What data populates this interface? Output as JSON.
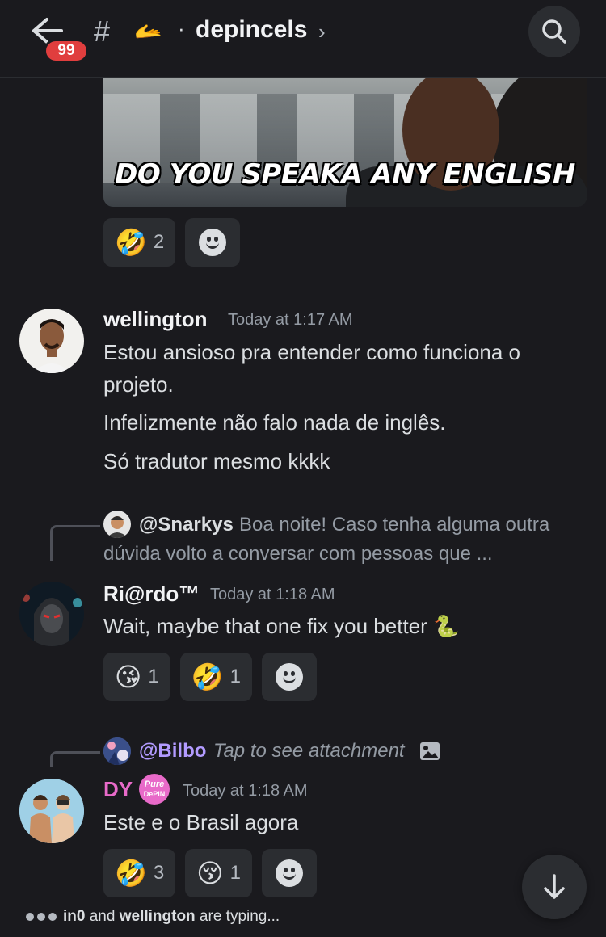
{
  "header": {
    "unread_badge": "99",
    "channel_hash": "#",
    "channel_emoji": "🫴",
    "channel_separator": "·",
    "channel_name": "depincels",
    "chevron": "›"
  },
  "embed": {
    "caption": "DO YOU SPEAKA ANY ENGLISH",
    "reactions": [
      {
        "emoji": "🤣",
        "count": "2"
      }
    ]
  },
  "messages": [
    {
      "username": "wellington",
      "timestamp": "Today at 1:17 AM",
      "lines": [
        "Estou ansioso pra entender como funciona o projeto.",
        "Infelizmente não falo nada de inglês.",
        "Só tradutor mesmo kkkk"
      ]
    },
    {
      "reply": {
        "name": "@Snarkys",
        "text": "Boa noite! Caso tenha alguma outra dúvida volto a conversar com pessoas que ..."
      },
      "username": "Ri@rdo™",
      "timestamp": "Today at 1:18 AM",
      "text": "Wait, maybe that one fix you better",
      "text_emoji": "🐍",
      "reactions": [
        {
          "emoji": "😘",
          "count": "1"
        },
        {
          "emoji": "🤣",
          "count": "1"
        }
      ]
    },
    {
      "reply": {
        "name": "@Bilbo",
        "text": "Tap to see attachment"
      },
      "username": "DY",
      "tag_line1": "Pure",
      "tag_line2": "DePIN",
      "timestamp": "Today at 1:18 AM",
      "text": "Este e o Brasil agora",
      "reactions": [
        {
          "emoji": "🤣",
          "count": "3"
        },
        {
          "emoji": "😚",
          "count": "1"
        }
      ]
    }
  ],
  "typing": {
    "user1": "in0",
    "connector": " and ",
    "user2": "wellington",
    "suffix": " are typing..."
  },
  "colors": {
    "background": "#1a1a1e",
    "accent_pink": "#e86ac9",
    "mention_purple": "#b29bff",
    "badge_red": "#e03e3e"
  }
}
